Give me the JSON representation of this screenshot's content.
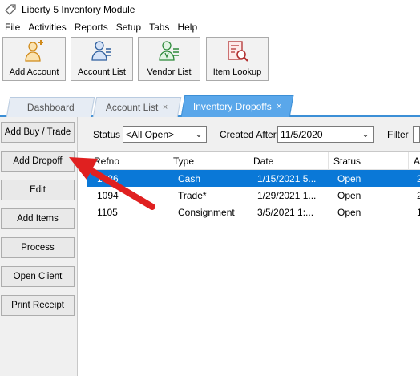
{
  "window": {
    "title": "Liberty 5 Inventory Module"
  },
  "menu": [
    "File",
    "Activities",
    "Reports",
    "Setup",
    "Tabs",
    "Help"
  ],
  "toolbar": [
    {
      "label": "Add Account",
      "icon": "add-account-icon"
    },
    {
      "label": "Account List",
      "icon": "account-list-icon"
    },
    {
      "label": "Vendor List",
      "icon": "vendor-list-icon"
    },
    {
      "label": "Item Lookup",
      "icon": "item-lookup-icon"
    }
  ],
  "tabs": [
    {
      "label": "Dashboard",
      "closable": false,
      "active": false
    },
    {
      "label": "Account List",
      "closable": true,
      "active": false
    },
    {
      "label": "Inventory Dropoffs",
      "closable": true,
      "active": true
    }
  ],
  "tab_close_glyph": "×",
  "sidebar": [
    "Add Buy / Trade",
    "Add Dropoff",
    "Edit",
    "Add Items",
    "Process",
    "Open Client",
    "Print Receipt"
  ],
  "filters": {
    "status_label": "Status",
    "status_value": "<All Open>",
    "created_after_label": "Created After",
    "created_after_value": "11/5/2020",
    "filter_label": "Filter"
  },
  "grid": {
    "columns": [
      "Refno",
      "Type",
      "Date",
      "Status",
      "A"
    ],
    "rows": [
      {
        "refno": "1086",
        "type": "Cash",
        "date": "1/15/2021 5...",
        "status": "Open",
        "a": "2",
        "selected": true
      },
      {
        "refno": "1094",
        "type": "Trade*",
        "date": "1/29/2021 1...",
        "status": "Open",
        "a": "2",
        "selected": false
      },
      {
        "refno": "1105",
        "type": "Consignment",
        "date": "3/5/2021 1:...",
        "status": "Open",
        "a": "1",
        "selected": false
      }
    ]
  },
  "colors": {
    "accent": "#5aa7ea",
    "selection": "#0a78d7",
    "annotation_arrow": "#e02020"
  },
  "annotation": {
    "points_to": "Add Dropoff"
  }
}
